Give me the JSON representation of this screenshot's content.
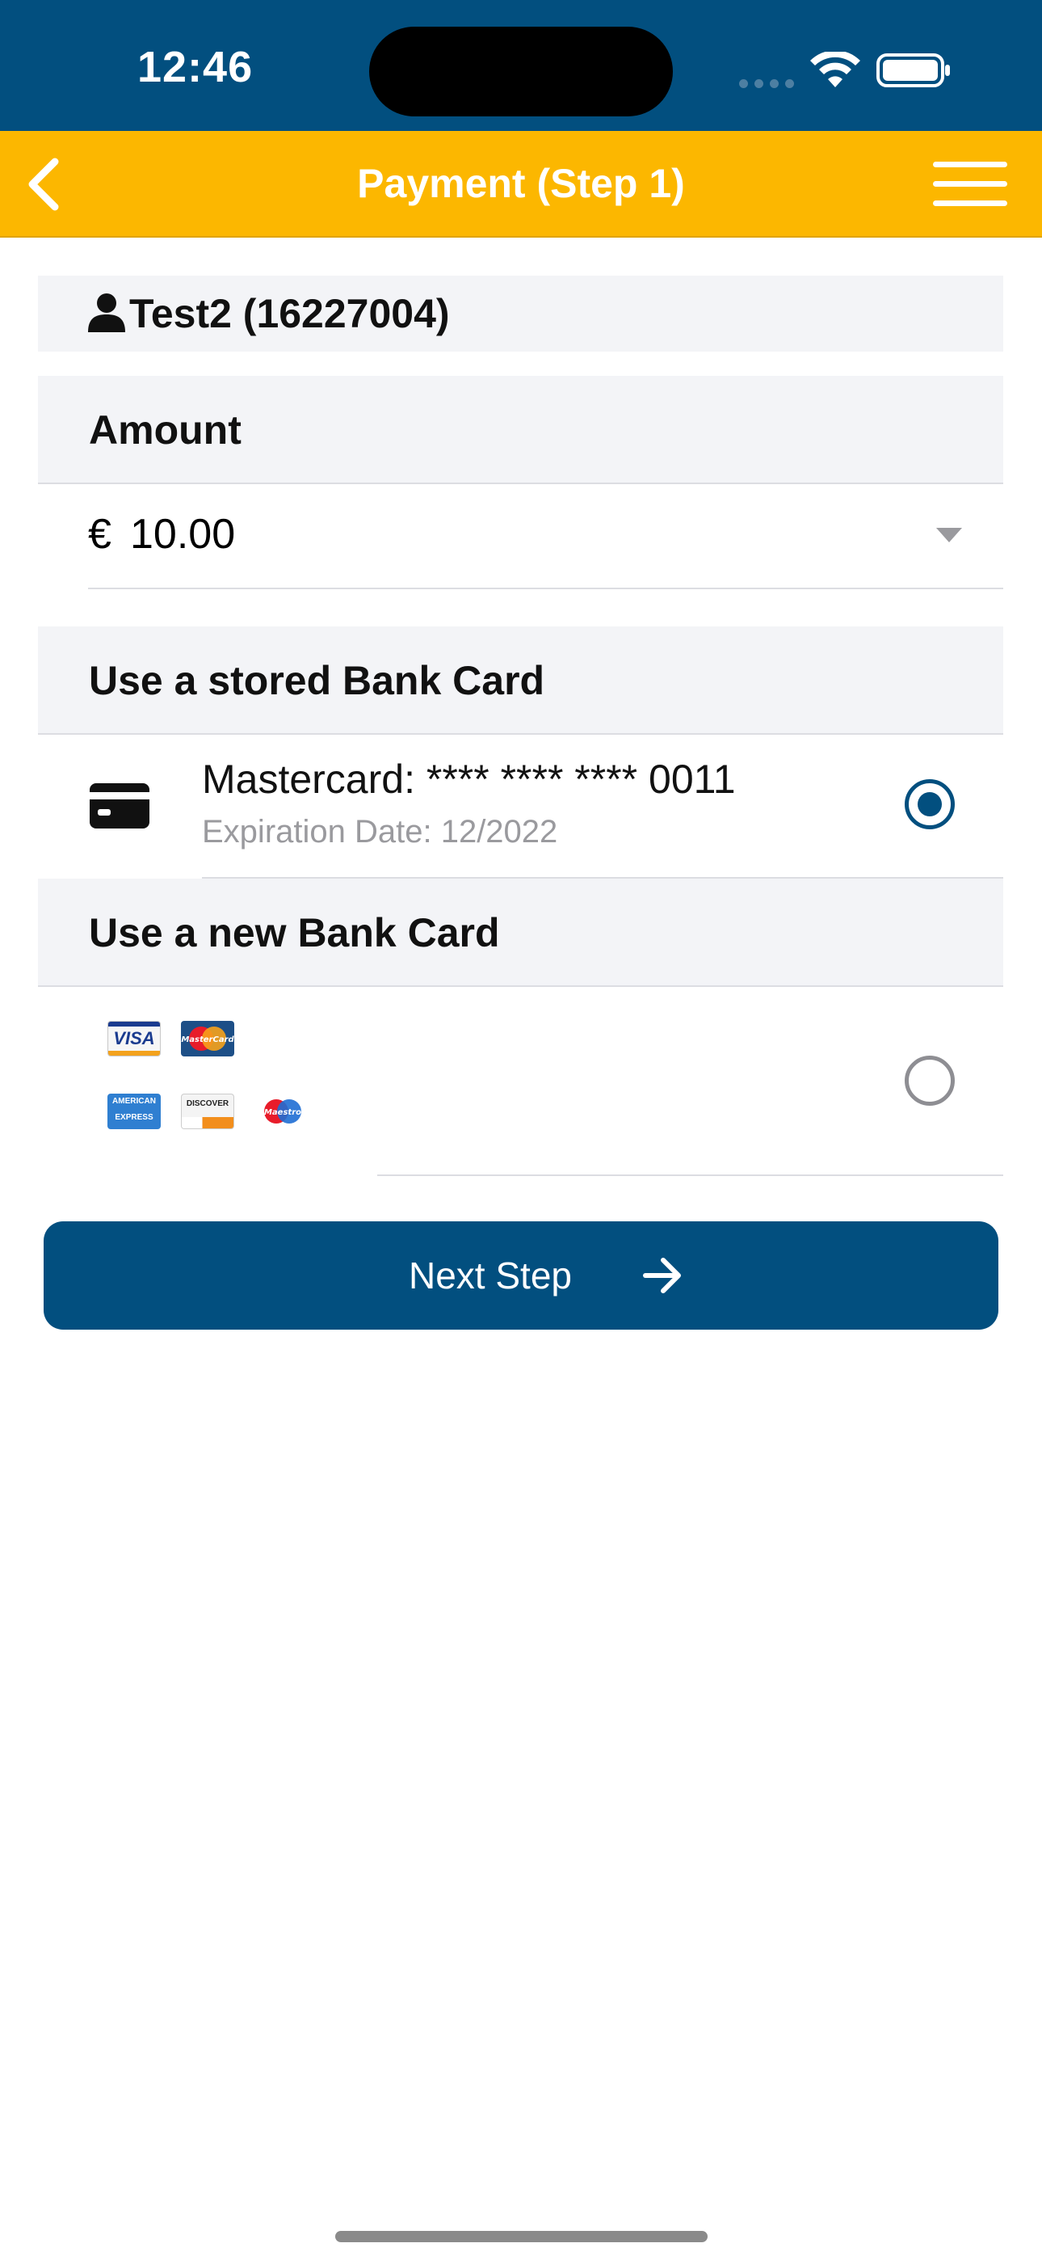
{
  "status_bar": {
    "time": "12:46"
  },
  "nav": {
    "title": "Payment (Step 1)"
  },
  "user": {
    "display": "Test2 (16227004)"
  },
  "amount": {
    "header": "Amount",
    "currency": "€",
    "value": "10.00"
  },
  "stored_card": {
    "header": "Use a stored Bank Card",
    "title": "Mastercard: **** **** **** 0011",
    "expiry": "Expiration Date: 12/2022",
    "selected": true
  },
  "new_card": {
    "header": "Use a new Bank Card",
    "brands": [
      "VISA",
      "MasterCard",
      "AMERICAN EXPRESS",
      "DISCOVER",
      "Maestro"
    ],
    "selected": false
  },
  "next_button": {
    "label": "Next Step"
  },
  "colors": {
    "primary": "#024f7f",
    "accent": "#fcb700",
    "section_bg": "#f3f4f7"
  }
}
